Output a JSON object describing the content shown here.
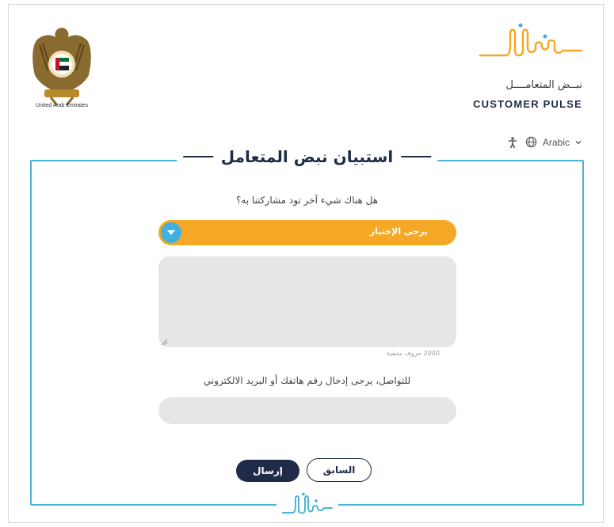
{
  "header": {
    "uae_caption": "United Arab Emirates",
    "brand_arabic": "نبــض المتعامــــل",
    "brand_english": "CUSTOMER PULSE"
  },
  "language": {
    "selected": "Arabic"
  },
  "survey": {
    "title": "استبيان نبض المتعامل",
    "question_1": "هل هناك شيء آخر تود مشاركتنا به؟",
    "dropdown_value": "يرجى الإختيار",
    "textarea_value": "",
    "chars_remaining": "2000 حروف متبقية",
    "question_2": "للتواصل، يرجى إدخال رقم هاتفك أو البريد الالكتروني",
    "contact_value": ""
  },
  "buttons": {
    "previous": "السابق",
    "send": "إرسال"
  },
  "colors": {
    "navy": "#1f2b48",
    "accent_orange": "#f5a726",
    "accent_blue": "#49b6d8",
    "input_bg": "#e5e7e6"
  },
  "icons": [
    "uae-emblem-icon",
    "customer-pulse-logo-icon",
    "accessibility-icon",
    "globe-icon",
    "chevron-down-icon",
    "caret-down-icon",
    "resize-handle-icon"
  ]
}
